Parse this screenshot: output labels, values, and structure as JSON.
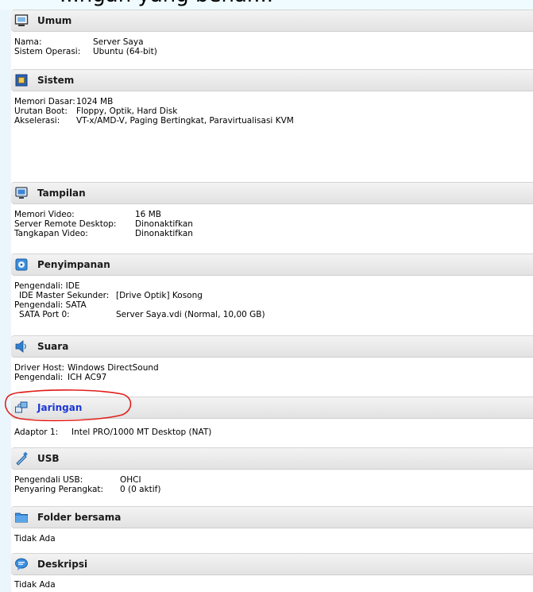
{
  "banner": {
    "text": "...ngan yang benar..."
  },
  "sections": [
    {
      "id": "general",
      "title": "Umum",
      "icon": "monitor-icon",
      "rows": [
        {
          "label": "Nama:",
          "value": "Server Saya"
        },
        {
          "label": "Sistem Operasi:",
          "value": "Ubuntu (64-bit)"
        }
      ]
    },
    {
      "id": "system",
      "title": "Sistem",
      "icon": "chip-icon",
      "rows": [
        {
          "label": "Memori Dasar:",
          "value": "1024 MB"
        },
        {
          "label": "Urutan Boot:",
          "value": "Floppy, Optik, Hard Disk"
        },
        {
          "label": "Akselerasi:",
          "value": "VT-x/AMD-V, Paging Bertingkat, Paravirtualisasi KVM"
        }
      ]
    },
    {
      "id": "display",
      "title": "Tampilan",
      "icon": "display-icon",
      "rows": [
        {
          "label": "Memori Video:",
          "value": "16 MB"
        },
        {
          "label": "Server Remote Desktop:",
          "value": "Dinonaktifkan"
        },
        {
          "label": "Tangkapan Video:",
          "value": "Dinonaktifkan"
        }
      ]
    },
    {
      "id": "storage",
      "title": "Penyimpanan",
      "icon": "storage-icon",
      "rows": [
        {
          "label": "Pengendali: IDE",
          "value": ""
        },
        {
          "label": " IDE Master Sekunder:",
          "value": "[Drive Optik] Kosong"
        },
        {
          "label": "Pengendali: SATA",
          "value": ""
        },
        {
          "label": " SATA Port 0:",
          "value": "Server Saya.vdi (Normal, 10,00 GB)"
        }
      ]
    },
    {
      "id": "audio",
      "title": "Suara",
      "icon": "speaker-icon",
      "rows": [
        {
          "label": "Driver Host:",
          "value": "Windows DirectSound"
        },
        {
          "label": "Pengendali:",
          "value": "ICH AC97"
        }
      ]
    },
    {
      "id": "network",
      "title": "Jaringan",
      "icon": "network-icon",
      "rows": [
        {
          "label": "Adaptor 1:",
          "value": "Intel PRO/1000 MT Desktop (NAT)"
        }
      ]
    },
    {
      "id": "usb",
      "title": "USB",
      "icon": "usb-icon",
      "rows": [
        {
          "label": "Pengendali USB:",
          "value": "OHCI"
        },
        {
          "label": "Penyaring Perangkat:",
          "value": "0 (0 aktif)"
        }
      ]
    },
    {
      "id": "shared",
      "title": "Folder bersama",
      "icon": "folder-icon",
      "rows": [
        {
          "label": "Tidak Ada",
          "value": ""
        }
      ]
    },
    {
      "id": "description",
      "title": "Deskripsi",
      "icon": "speech-bubble-icon",
      "rows": [
        {
          "label": "Tidak Ada",
          "value": ""
        }
      ]
    }
  ],
  "colors": {
    "header_bg": "#e8e8e8",
    "link_blue": "#1c36d4",
    "annotation_red": "#e0201b",
    "icon_blue": "#2f7fd0"
  }
}
